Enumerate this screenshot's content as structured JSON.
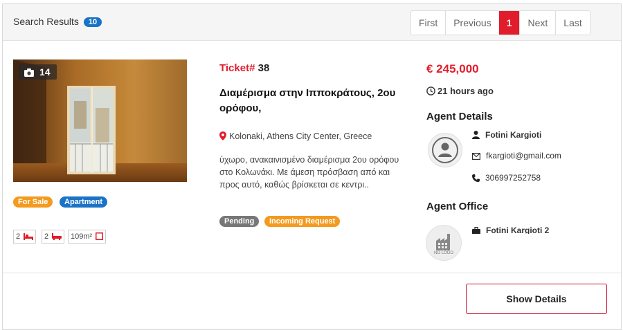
{
  "header": {
    "title": "Search Results",
    "count": "10"
  },
  "pagination": {
    "first": "First",
    "previous": "Previous",
    "current": "1",
    "next": "Next",
    "last": "Last"
  },
  "listing": {
    "photo_count": "14",
    "tags": [
      "For Sale",
      "Apartment"
    ],
    "features": {
      "bedrooms": "2",
      "bathrooms": "2",
      "area": "109m²"
    },
    "ticket_label": "Ticket#",
    "ticket_number": "38",
    "title": "Διαμέρισμα στην Ιπποκράτους, 2ου ορόφου,",
    "location": "Kolonaki, Athens City Center, Greece",
    "description": "ύχωρο, ανακαινισμένο διαμέρισμα 2ου ορόφου στο Κολωνάκι. Με άμεση πρόσβαση από και προς αυτό, καθώς βρίσκεται σε κεντρι..",
    "statuses": [
      "Pending",
      "Incoming Request"
    ],
    "price": "€ 245,000",
    "time_ago": "21 hours ago"
  },
  "agent": {
    "section_title": "Agent Details",
    "name": "Fotini Kargioti",
    "email": "fkargioti@gmail.com",
    "phone": "306997252758"
  },
  "office": {
    "section_title": "Agent Office",
    "name": "Fotini Kargioti 2",
    "logo_text": "NO LOGO"
  },
  "actions": {
    "show_details": "Show Details"
  },
  "colors": {
    "accent": "#e11d2b",
    "primary_badge": "#1a73c7",
    "sale_badge": "#f39a1f",
    "pending_badge": "#777777"
  }
}
